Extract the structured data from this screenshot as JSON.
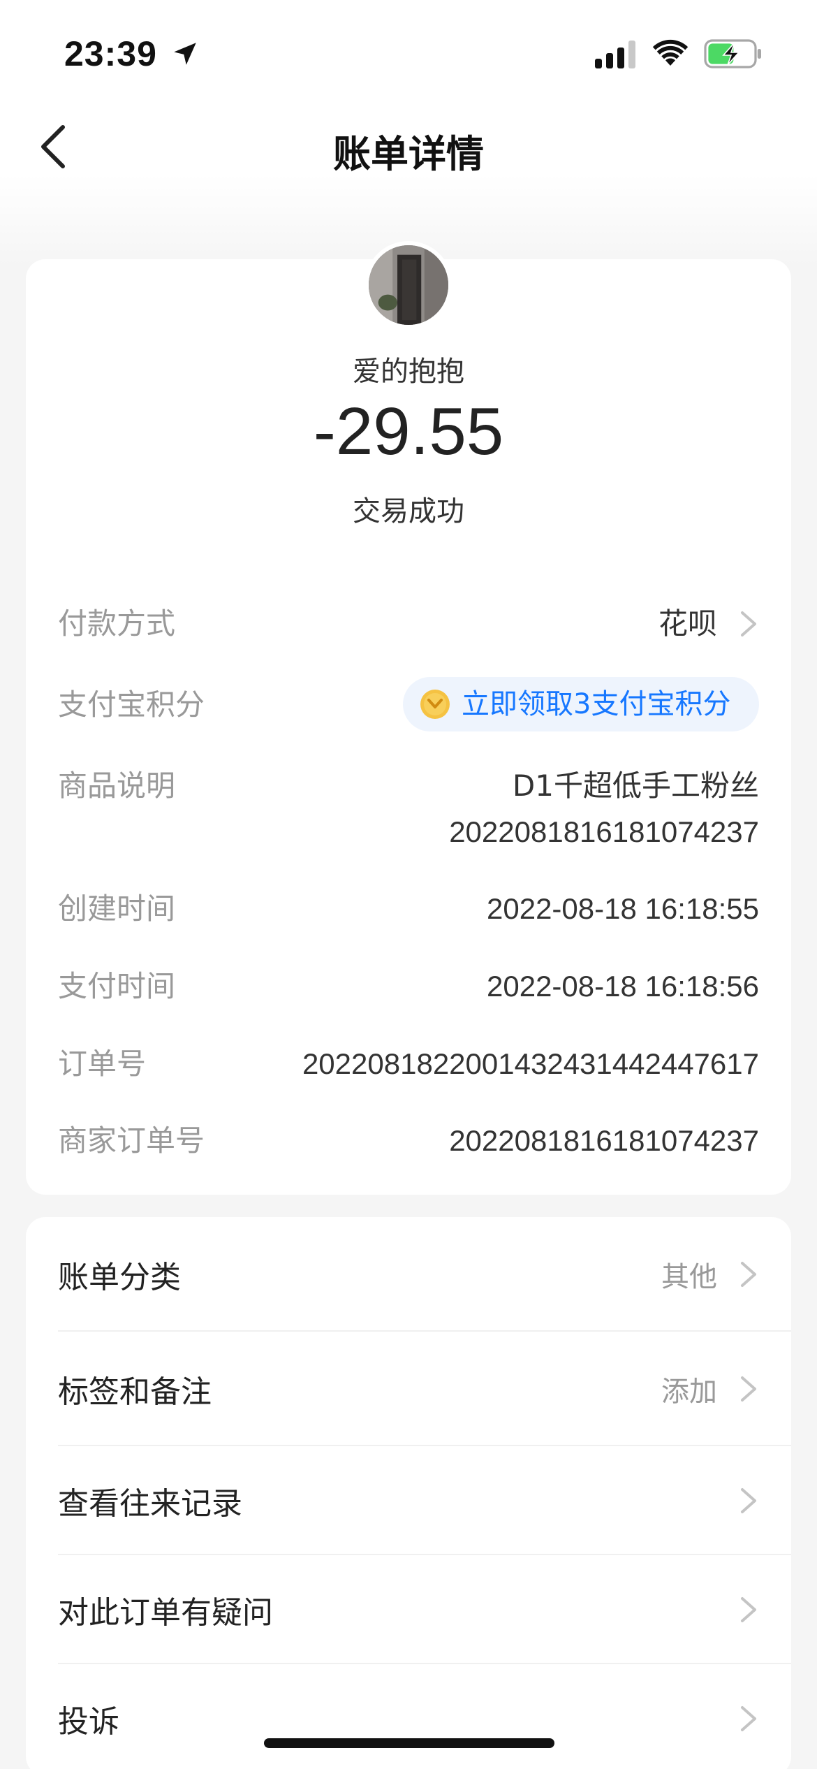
{
  "status_bar": {
    "time": "23:39"
  },
  "nav": {
    "title": "账单详情"
  },
  "transaction": {
    "merchant": "爱的抱抱",
    "amount": "-29.55",
    "status": "交易成功"
  },
  "details": {
    "payment_method": {
      "label": "付款方式",
      "value": "花呗"
    },
    "points": {
      "label": "支付宝积分",
      "value": "立即领取3支付宝积分"
    },
    "product": {
      "label": "商品说明",
      "line1": "D1千超低手工粉丝",
      "line2": "20220818161810742​37"
    },
    "created": {
      "label": "创建时间",
      "value": "2022-08-18 16:18:55"
    },
    "paid": {
      "label": "支付时间",
      "value": "2022-08-18 16:18:56"
    },
    "order_no": {
      "label": "订单号",
      "value": "2022081822001432431442447617"
    },
    "merchant_order_no": {
      "label": "商家订单号",
      "value": "20220818161810742​37"
    }
  },
  "actions": [
    {
      "label": "账单分类",
      "value": "其他"
    },
    {
      "label": "标签和备注",
      "value": "添加"
    },
    {
      "label": "查看往来记录",
      "value": ""
    },
    {
      "label": "对此订单有疑问",
      "value": ""
    },
    {
      "label": "投诉",
      "value": ""
    }
  ],
  "colors": {
    "accent": "#1677ff",
    "label_gray": "#999999",
    "text": "#333333"
  }
}
